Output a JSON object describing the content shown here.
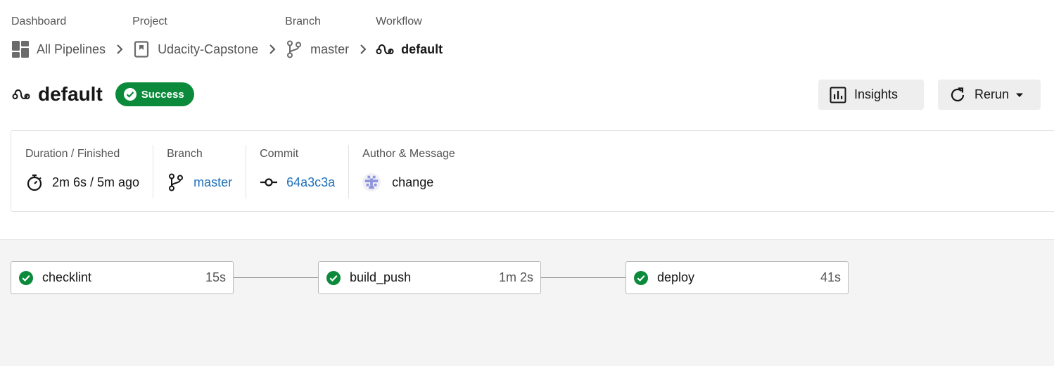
{
  "breadcrumb": [
    {
      "label": "Dashboard",
      "value": "All Pipelines",
      "icon": "dashboard-icon"
    },
    {
      "label": "Project",
      "value": "Udacity-Capstone",
      "icon": "project-icon"
    },
    {
      "label": "Branch",
      "value": "master",
      "icon": "branch-icon"
    },
    {
      "label": "Workflow",
      "value": "default",
      "icon": "workflow-icon"
    }
  ],
  "header": {
    "title": "default",
    "status": "Success",
    "insights_label": "Insights",
    "rerun_label": "Rerun"
  },
  "info": {
    "duration_label": "Duration / Finished",
    "duration_value": "2m 6s / 5m ago",
    "branch_label": "Branch",
    "branch_value": "master",
    "commit_label": "Commit",
    "commit_value": "64a3c3a",
    "author_label": "Author & Message",
    "message": "change"
  },
  "jobs": [
    {
      "name": "checklint",
      "duration": "15s",
      "status": "success"
    },
    {
      "name": "build_push",
      "duration": "1m 2s",
      "status": "success"
    },
    {
      "name": "deploy",
      "duration": "41s",
      "status": "success"
    }
  ],
  "colors": {
    "success": "#0a8a3a",
    "link": "#1d6fb8",
    "avatar": "#8e95dd"
  }
}
